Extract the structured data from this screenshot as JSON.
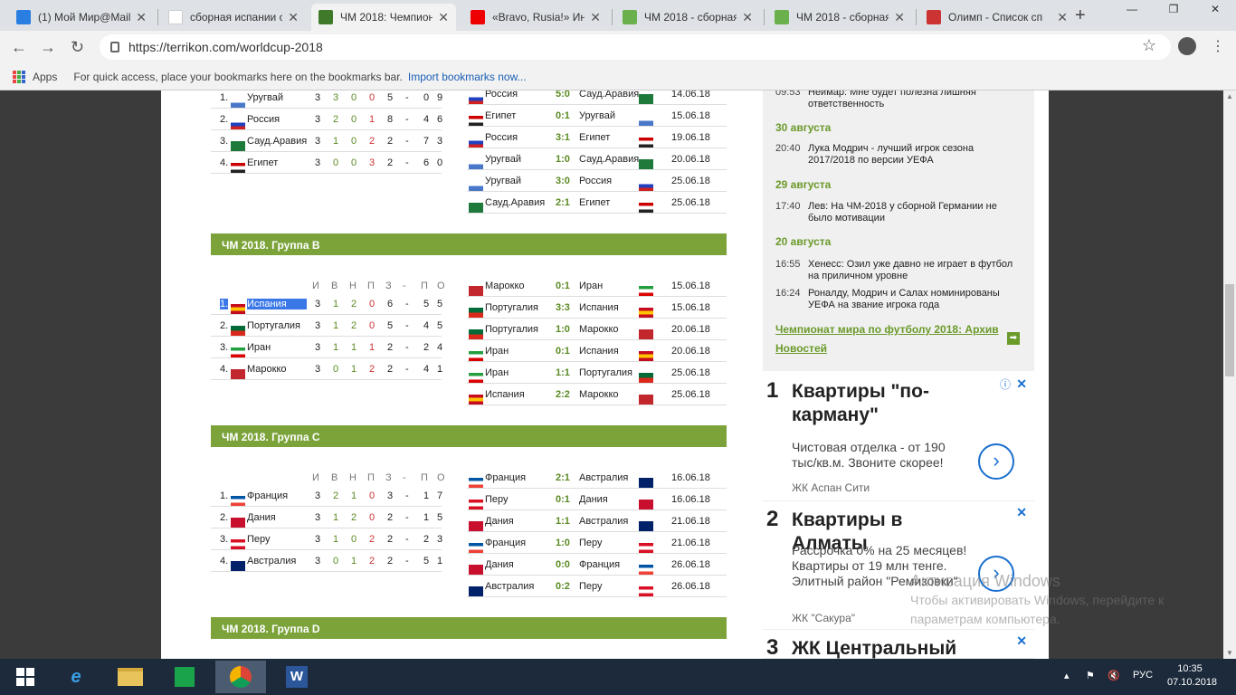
{
  "browser": {
    "tabs": [
      {
        "title": "(1) Мой Мир@Mail",
        "fav": "mymir-icon",
        "color": "#2a7de1"
      },
      {
        "title": "сборная испании с",
        "fav": "google-icon",
        "color": "#ffffff"
      },
      {
        "title": "ЧМ 2018: Чемпион",
        "fav": "terrikon-icon",
        "color": "#3f7a2a"
      },
      {
        "title": "«Bravo, Rusia!» Ин",
        "fav": "youtube-icon",
        "color": "#e00"
      },
      {
        "title": "ЧМ 2018 - сборная",
        "fav": "green-square-icon",
        "color": "#6ab04c"
      },
      {
        "title": "ЧМ 2018 - сборная",
        "fav": "green-square-icon",
        "color": "#6ab04c"
      },
      {
        "title": "Олимп - Список сп",
        "fav": "olimp-icon",
        "color": "#c33"
      }
    ],
    "url": "https://terrikon.com/worldcup-2018",
    "bookmarks": {
      "apps": "Apps",
      "hint": "For quick access, place your bookmarks here on the bookmarks bar.",
      "import": "Import bookmarks now..."
    }
  },
  "headers": {
    "i": "И",
    "v": "В",
    "n": "Н",
    "p": "П",
    "z": "З",
    "dash": "-",
    "pr": "П",
    "o": "О"
  },
  "groupA": {
    "standings": [
      {
        "pos": "1.",
        "team": "Уругвай",
        "flag": "uy",
        "g": "3",
        "w": "3",
        "d": "0",
        "l": "0",
        "gf": "5",
        "ga": "0",
        "pts": "9"
      },
      {
        "pos": "2.",
        "team": "Россия",
        "flag": "ru",
        "g": "3",
        "w": "2",
        "d": "0",
        "l": "1",
        "gf": "8",
        "ga": "4",
        "pts": "6"
      },
      {
        "pos": "3.",
        "team": "Сауд.Аравия",
        "flag": "sa",
        "g": "3",
        "w": "1",
        "d": "0",
        "l": "2",
        "gf": "2",
        "ga": "7",
        "pts": "3"
      },
      {
        "pos": "4.",
        "team": "Египет",
        "flag": "eg",
        "g": "3",
        "w": "0",
        "d": "0",
        "l": "3",
        "gf": "2",
        "ga": "6",
        "pts": "0"
      }
    ],
    "matches": [
      {
        "home": "Россия",
        "hf": "ru",
        "score": "5:0",
        "away": "Сауд.Аравия",
        "af": "sa",
        "date": "14.06.18"
      },
      {
        "home": "Египет",
        "hf": "eg",
        "score": "0:1",
        "away": "Уругвай",
        "af": "uy",
        "date": "15.06.18"
      },
      {
        "home": "Россия",
        "hf": "ru",
        "score": "3:1",
        "away": "Египет",
        "af": "eg",
        "date": "19.06.18"
      },
      {
        "home": "Уругвай",
        "hf": "uy",
        "score": "1:0",
        "away": "Сауд.Аравия",
        "af": "sa",
        "date": "20.06.18"
      },
      {
        "home": "Уругвай",
        "hf": "uy",
        "score": "3:0",
        "away": "Россия",
        "af": "ru",
        "date": "25.06.18"
      },
      {
        "home": "Сауд.Аравия",
        "hf": "sa",
        "score": "2:1",
        "away": "Египет",
        "af": "eg",
        "date": "25.06.18"
      }
    ]
  },
  "groupB": {
    "title": "ЧМ 2018. Группа B",
    "standings": [
      {
        "pos": "1.",
        "team": "Испания",
        "flag": "es",
        "g": "3",
        "w": "1",
        "d": "2",
        "l": "0",
        "gf": "6",
        "ga": "5",
        "pts": "5"
      },
      {
        "pos": "2.",
        "team": "Португалия",
        "flag": "pt",
        "g": "3",
        "w": "1",
        "d": "2",
        "l": "0",
        "gf": "5",
        "ga": "4",
        "pts": "5"
      },
      {
        "pos": "3.",
        "team": "Иран",
        "flag": "ir",
        "g": "3",
        "w": "1",
        "d": "1",
        "l": "1",
        "gf": "2",
        "ga": "2",
        "pts": "4"
      },
      {
        "pos": "4.",
        "team": "Марокко",
        "flag": "ma",
        "g": "3",
        "w": "0",
        "d": "1",
        "l": "2",
        "gf": "2",
        "ga": "4",
        "pts": "1"
      }
    ],
    "matches": [
      {
        "home": "Марокко",
        "hf": "ma",
        "score": "0:1",
        "away": "Иран",
        "af": "ir",
        "date": "15.06.18"
      },
      {
        "home": "Португалия",
        "hf": "pt",
        "score": "3:3",
        "away": "Испания",
        "af": "es",
        "date": "15.06.18"
      },
      {
        "home": "Португалия",
        "hf": "pt",
        "score": "1:0",
        "away": "Марокко",
        "af": "ma",
        "date": "20.06.18"
      },
      {
        "home": "Иран",
        "hf": "ir",
        "score": "0:1",
        "away": "Испания",
        "af": "es",
        "date": "20.06.18"
      },
      {
        "home": "Иран",
        "hf": "ir",
        "score": "1:1",
        "away": "Португалия",
        "af": "pt",
        "date": "25.06.18"
      },
      {
        "home": "Испания",
        "hf": "es",
        "score": "2:2",
        "away": "Марокко",
        "af": "ma",
        "date": "25.06.18"
      }
    ]
  },
  "groupC": {
    "title": "ЧМ 2018. Группа C",
    "standings": [
      {
        "pos": "1.",
        "team": "Франция",
        "flag": "fr",
        "g": "3",
        "w": "2",
        "d": "1",
        "l": "0",
        "gf": "3",
        "ga": "1",
        "pts": "7"
      },
      {
        "pos": "2.",
        "team": "Дания",
        "flag": "dk",
        "g": "3",
        "w": "1",
        "d": "2",
        "l": "0",
        "gf": "2",
        "ga": "1",
        "pts": "5"
      },
      {
        "pos": "3.",
        "team": "Перу",
        "flag": "pe",
        "g": "3",
        "w": "1",
        "d": "0",
        "l": "2",
        "gf": "2",
        "ga": "2",
        "pts": "3"
      },
      {
        "pos": "4.",
        "team": "Австралия",
        "flag": "au",
        "g": "3",
        "w": "0",
        "d": "1",
        "l": "2",
        "gf": "2",
        "ga": "5",
        "pts": "1"
      }
    ],
    "matches": [
      {
        "home": "Франция",
        "hf": "fr",
        "score": "2:1",
        "away": "Австралия",
        "af": "au",
        "date": "16.06.18"
      },
      {
        "home": "Перу",
        "hf": "pe",
        "score": "0:1",
        "away": "Дания",
        "af": "dk",
        "date": "16.06.18"
      },
      {
        "home": "Дания",
        "hf": "dk",
        "score": "1:1",
        "away": "Австралия",
        "af": "au",
        "date": "21.06.18"
      },
      {
        "home": "Франция",
        "hf": "fr",
        "score": "1:0",
        "away": "Перу",
        "af": "pe",
        "date": "21.06.18"
      },
      {
        "home": "Дания",
        "hf": "dk",
        "score": "0:0",
        "away": "Франция",
        "af": "fr",
        "date": "26.06.18"
      },
      {
        "home": "Австралия",
        "hf": "au",
        "score": "0:2",
        "away": "Перу",
        "af": "pe",
        "date": "26.06.18"
      }
    ]
  },
  "groupD": {
    "title": "ЧМ 2018. Группа D"
  },
  "news": {
    "items": [
      {
        "time": "09:53",
        "text": "Неймар: Мне будет полезна лишняя ответственность"
      },
      {
        "day": "30 августа"
      },
      {
        "time": "20:40",
        "text": "Лука Модрич - лучший игрок сезона 2017/2018 по версии УЕФА"
      },
      {
        "day": "29 августа"
      },
      {
        "time": "17:40",
        "text": "Лев: На ЧМ-2018 у сборной Германии не было мотивации"
      },
      {
        "day": "20 августа"
      },
      {
        "time": "16:55",
        "text": "Хенесс: Озил уже давно не играет в футбол на приличном уровне"
      },
      {
        "time": "16:24",
        "text": "Роналду, Модрич и Салах номинированы УЕФА на звание игрока года"
      }
    ],
    "archive": "Чемпионат мира по футболу 2018: Архив Новостей"
  },
  "ads": [
    {
      "num": "1",
      "title": "Квартиры \"по-карману\"",
      "text": "Чистовая отделка - от 190 тыс/кв.м. Звоните скорее!",
      "src": "ЖК Аспан Сити"
    },
    {
      "num": "2",
      "title": "Квартиры в Алматы",
      "text": "Рассрочка 0% на 25 месяцев! Квартиры от 19 млн тенге. Элитный район \"Ремизовки\"",
      "src": "ЖК \"Сакура\""
    },
    {
      "num": "3",
      "title": "ЖК Центральный в"
    }
  ],
  "watermark": {
    "line1": "Активация Windows",
    "line2": "Чтобы активировать Windows, перейдите к параметрам компьютера."
  },
  "taskbar": {
    "lang": "РУС",
    "time": "10:35",
    "date": "07.10.2018"
  },
  "flagColors": {
    "uy": [
      "#ffffff",
      "#4a78c8"
    ],
    "ru": [
      "#ffffff",
      "#2040c0",
      "#d02020"
    ],
    "sa": [
      "#1e7a3a"
    ],
    "eg": [
      "#c00",
      "#ffffff",
      "#222"
    ],
    "es": [
      "#c60b1e",
      "#ffc400",
      "#c60b1e"
    ],
    "pt": [
      "#046a38",
      "#da291c"
    ],
    "ir": [
      "#239f40",
      "#ffffff",
      "#da0000"
    ],
    "ma": [
      "#c1272d"
    ],
    "fr": [
      "#0055a4",
      "#ffffff",
      "#ef4135"
    ],
    "dk": [
      "#c8102e"
    ],
    "pe": [
      "#d91023",
      "#ffffff",
      "#d91023"
    ],
    "au": [
      "#012169"
    ]
  }
}
